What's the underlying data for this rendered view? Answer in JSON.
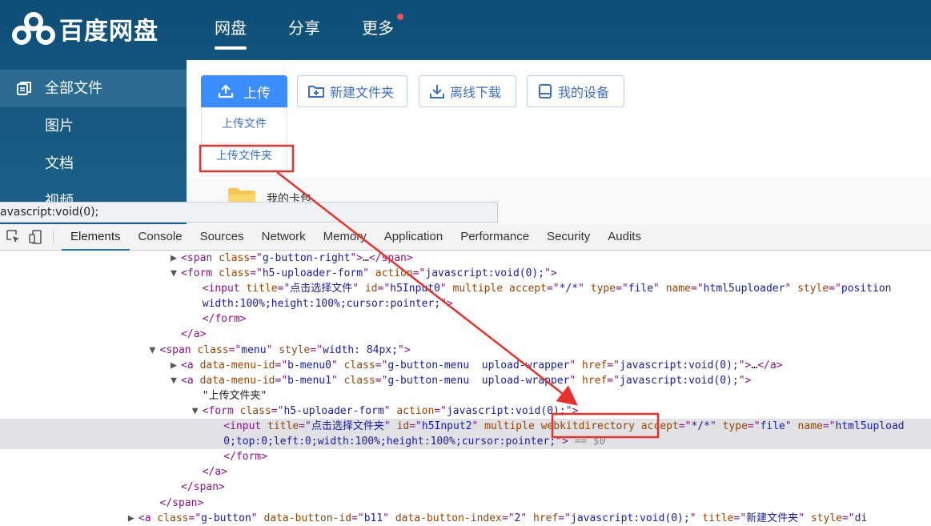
{
  "app": {
    "logo_text": "百度网盘",
    "brand_color": "#0d4e77",
    "accent_color": "#3b8cfe"
  },
  "topnav": {
    "tabs": [
      {
        "label": "网盘",
        "active": true
      },
      {
        "label": "分享",
        "active": false
      },
      {
        "label": "更多",
        "active": false,
        "badge": "red-dot"
      }
    ]
  },
  "sidebar": {
    "items": [
      {
        "label": "全部文件",
        "icon": "files-icon",
        "active": true
      },
      {
        "label": "图片"
      },
      {
        "label": "文档"
      },
      {
        "label": "视频"
      }
    ]
  },
  "toolbar": {
    "upload_label": "上传",
    "new_folder_label": "新建文件夹",
    "offline_download_label": "离线下载",
    "my_devices_label": "我的设备"
  },
  "upload_menu": {
    "items": [
      {
        "label": "上传文件"
      },
      {
        "label": "上传文件夹",
        "highlighted": true
      }
    ]
  },
  "file_list": {
    "first_folder": "我的卡包"
  },
  "status_bar": {
    "text": "avascript:void(0);"
  },
  "devtools": {
    "tabs": [
      "Elements",
      "Console",
      "Sources",
      "Network",
      "Memory",
      "Application",
      "Performance",
      "Security",
      "Audits"
    ],
    "active_tab": "Elements",
    "code_lines": [
      {
        "indent": 17,
        "tri": "▶",
        "parts": [
          [
            "tg",
            "<span "
          ],
          [
            "an",
            "class"
          ],
          [
            "tg",
            "=\""
          ],
          [
            "av",
            "g-button-right"
          ],
          [
            "tg",
            "\">"
          ],
          [
            "tx",
            "…"
          ],
          [
            "tg",
            "</span>"
          ]
        ]
      },
      {
        "indent": 17,
        "tri": "▼",
        "parts": [
          [
            "tg",
            "<form "
          ],
          [
            "an",
            "class"
          ],
          [
            "tg",
            "=\""
          ],
          [
            "av",
            "h5-uploader-form"
          ],
          [
            "tg",
            "\" "
          ],
          [
            "an",
            "action"
          ],
          [
            "tg",
            "=\""
          ],
          [
            "av",
            "javascript:void(0);"
          ],
          [
            "tg",
            "\">"
          ]
        ]
      },
      {
        "indent": 19,
        "tri": "",
        "parts": [
          [
            "tg",
            "<input "
          ],
          [
            "an",
            "title"
          ],
          [
            "tg",
            "=\""
          ],
          [
            "av",
            "点击选择文件"
          ],
          [
            "tg",
            "\" "
          ],
          [
            "an",
            "id"
          ],
          [
            "tg",
            "=\""
          ],
          [
            "av",
            "h5Input0"
          ],
          [
            "tg",
            "\" "
          ],
          [
            "an",
            "multiple "
          ],
          [
            "an",
            "accept"
          ],
          [
            "tg",
            "=\""
          ],
          [
            "av",
            "*/*"
          ],
          [
            "tg",
            "\" "
          ],
          [
            "an",
            "type"
          ],
          [
            "tg",
            "=\""
          ],
          [
            "av",
            "file"
          ],
          [
            "tg",
            "\" "
          ],
          [
            "an",
            "name"
          ],
          [
            "tg",
            "=\""
          ],
          [
            "av",
            "html5uploader"
          ],
          [
            "tg",
            "\" "
          ],
          [
            "an",
            "style"
          ],
          [
            "tg",
            "=\""
          ],
          [
            "av",
            "position"
          ]
        ]
      },
      {
        "indent": 19,
        "tri": "",
        "parts": [
          [
            "av",
            "width:100%;height:100%;cursor:pointer;"
          ],
          [
            "tg",
            "\">"
          ]
        ]
      },
      {
        "indent": 19,
        "tri": "",
        "parts": [
          [
            "tg",
            "</form>"
          ]
        ]
      },
      {
        "indent": 17,
        "tri": "",
        "parts": [
          [
            "tg",
            "</a>"
          ]
        ]
      },
      {
        "indent": 15,
        "tri": "▼",
        "parts": [
          [
            "tg",
            "<span "
          ],
          [
            "an",
            "class"
          ],
          [
            "tg",
            "=\""
          ],
          [
            "av",
            "menu"
          ],
          [
            "tg",
            "\" "
          ],
          [
            "an",
            "style"
          ],
          [
            "tg",
            "=\""
          ],
          [
            "av",
            "width: 84px;"
          ],
          [
            "tg",
            "\">"
          ]
        ]
      },
      {
        "indent": 17,
        "tri": "▶",
        "parts": [
          [
            "tg",
            "<a "
          ],
          [
            "an",
            "data-menu-id"
          ],
          [
            "tg",
            "=\""
          ],
          [
            "av",
            "b-menu0"
          ],
          [
            "tg",
            "\" "
          ],
          [
            "an",
            "class"
          ],
          [
            "tg",
            "=\""
          ],
          [
            "av",
            "g-button-menu  upload-wrapper"
          ],
          [
            "tg",
            "\" "
          ],
          [
            "an",
            "href"
          ],
          [
            "tg",
            "=\""
          ],
          [
            "av",
            "javascript:void(0);"
          ],
          [
            "tg",
            "\">"
          ],
          [
            "tx",
            "…"
          ],
          [
            "tg",
            "</a>"
          ]
        ]
      },
      {
        "indent": 17,
        "tri": "▼",
        "parts": [
          [
            "tg",
            "<a "
          ],
          [
            "an",
            "data-menu-id"
          ],
          [
            "tg",
            "=\""
          ],
          [
            "av",
            "b-menu1"
          ],
          [
            "tg",
            "\" "
          ],
          [
            "an",
            "class"
          ],
          [
            "tg",
            "=\""
          ],
          [
            "av",
            "g-button-menu  upload-wrapper"
          ],
          [
            "tg",
            "\" "
          ],
          [
            "an",
            "href"
          ],
          [
            "tg",
            "=\""
          ],
          [
            "av",
            "javascript:void(0);"
          ],
          [
            "tg",
            "\">"
          ]
        ]
      },
      {
        "indent": 19,
        "tri": "",
        "parts": [
          [
            "tx",
            "\"上传文件夹\""
          ]
        ]
      },
      {
        "indent": 19,
        "tri": "▼",
        "parts": [
          [
            "tg",
            "<form "
          ],
          [
            "an",
            "class"
          ],
          [
            "tg",
            "=\""
          ],
          [
            "av",
            "h5-uploader-form"
          ],
          [
            "tg",
            "\" "
          ],
          [
            "an",
            "action"
          ],
          [
            "tg",
            "=\""
          ],
          [
            "av",
            "javascript:void(0);"
          ],
          [
            "tg",
            "\">"
          ]
        ]
      },
      {
        "indent": 21,
        "tri": "",
        "sel": true,
        "parts": [
          [
            "tg",
            "<input "
          ],
          [
            "an",
            "title"
          ],
          [
            "tg",
            "=\""
          ],
          [
            "av",
            "点击选择文件夹"
          ],
          [
            "tg",
            "\" "
          ],
          [
            "an",
            "id"
          ],
          [
            "tg",
            "=\""
          ],
          [
            "av",
            "h5Input2"
          ],
          [
            "tg",
            "\" "
          ],
          [
            "an",
            "multiple "
          ],
          [
            "an",
            "webkitdirectory "
          ],
          [
            "an",
            "accept"
          ],
          [
            "tg",
            "=\""
          ],
          [
            "av",
            "*/*"
          ],
          [
            "tg",
            "\" "
          ],
          [
            "an",
            "type"
          ],
          [
            "tg",
            "=\""
          ],
          [
            "av",
            "file"
          ],
          [
            "tg",
            "\" "
          ],
          [
            "an",
            "name"
          ],
          [
            "tg",
            "=\""
          ],
          [
            "av",
            "html5upload"
          ]
        ]
      },
      {
        "indent": 21,
        "tri": "",
        "sel": true,
        "parts": [
          [
            "av",
            "0;top:0;left:0;width:100%;height:100%;cursor:pointer;"
          ],
          [
            "tg",
            "\">"
          ],
          [
            "gy",
            " == $0"
          ]
        ]
      },
      {
        "indent": 21,
        "tri": "",
        "parts": [
          [
            "tg",
            "</form>"
          ]
        ]
      },
      {
        "indent": 19,
        "tri": "",
        "parts": [
          [
            "tg",
            "</a>"
          ]
        ]
      },
      {
        "indent": 17,
        "tri": "",
        "parts": [
          [
            "tg",
            "</span>"
          ]
        ]
      },
      {
        "indent": 15,
        "tri": "",
        "parts": [
          [
            "tg",
            "</span>"
          ]
        ]
      },
      {
        "indent": 13,
        "tri": "▶",
        "parts": [
          [
            "tg",
            "<a "
          ],
          [
            "an",
            "class"
          ],
          [
            "tg",
            "=\""
          ],
          [
            "av",
            "g-button"
          ],
          [
            "tg",
            "\" "
          ],
          [
            "an",
            "data-button-id"
          ],
          [
            "tg",
            "=\""
          ],
          [
            "av",
            "b11"
          ],
          [
            "tg",
            "\" "
          ],
          [
            "an",
            "data-button-index"
          ],
          [
            "tg",
            "=\""
          ],
          [
            "av",
            "2"
          ],
          [
            "tg",
            "\" "
          ],
          [
            "an",
            "href"
          ],
          [
            "tg",
            "=\""
          ],
          [
            "av",
            "javascript:void(0);"
          ],
          [
            "tg",
            "\" "
          ],
          [
            "an",
            "title"
          ],
          [
            "tg",
            "=\""
          ],
          [
            "av",
            "新建文件夹"
          ],
          [
            "tg",
            "\" "
          ],
          [
            "an",
            "style"
          ],
          [
            "tg",
            "=\""
          ],
          [
            "av",
            "di"
          ]
        ]
      }
    ]
  }
}
